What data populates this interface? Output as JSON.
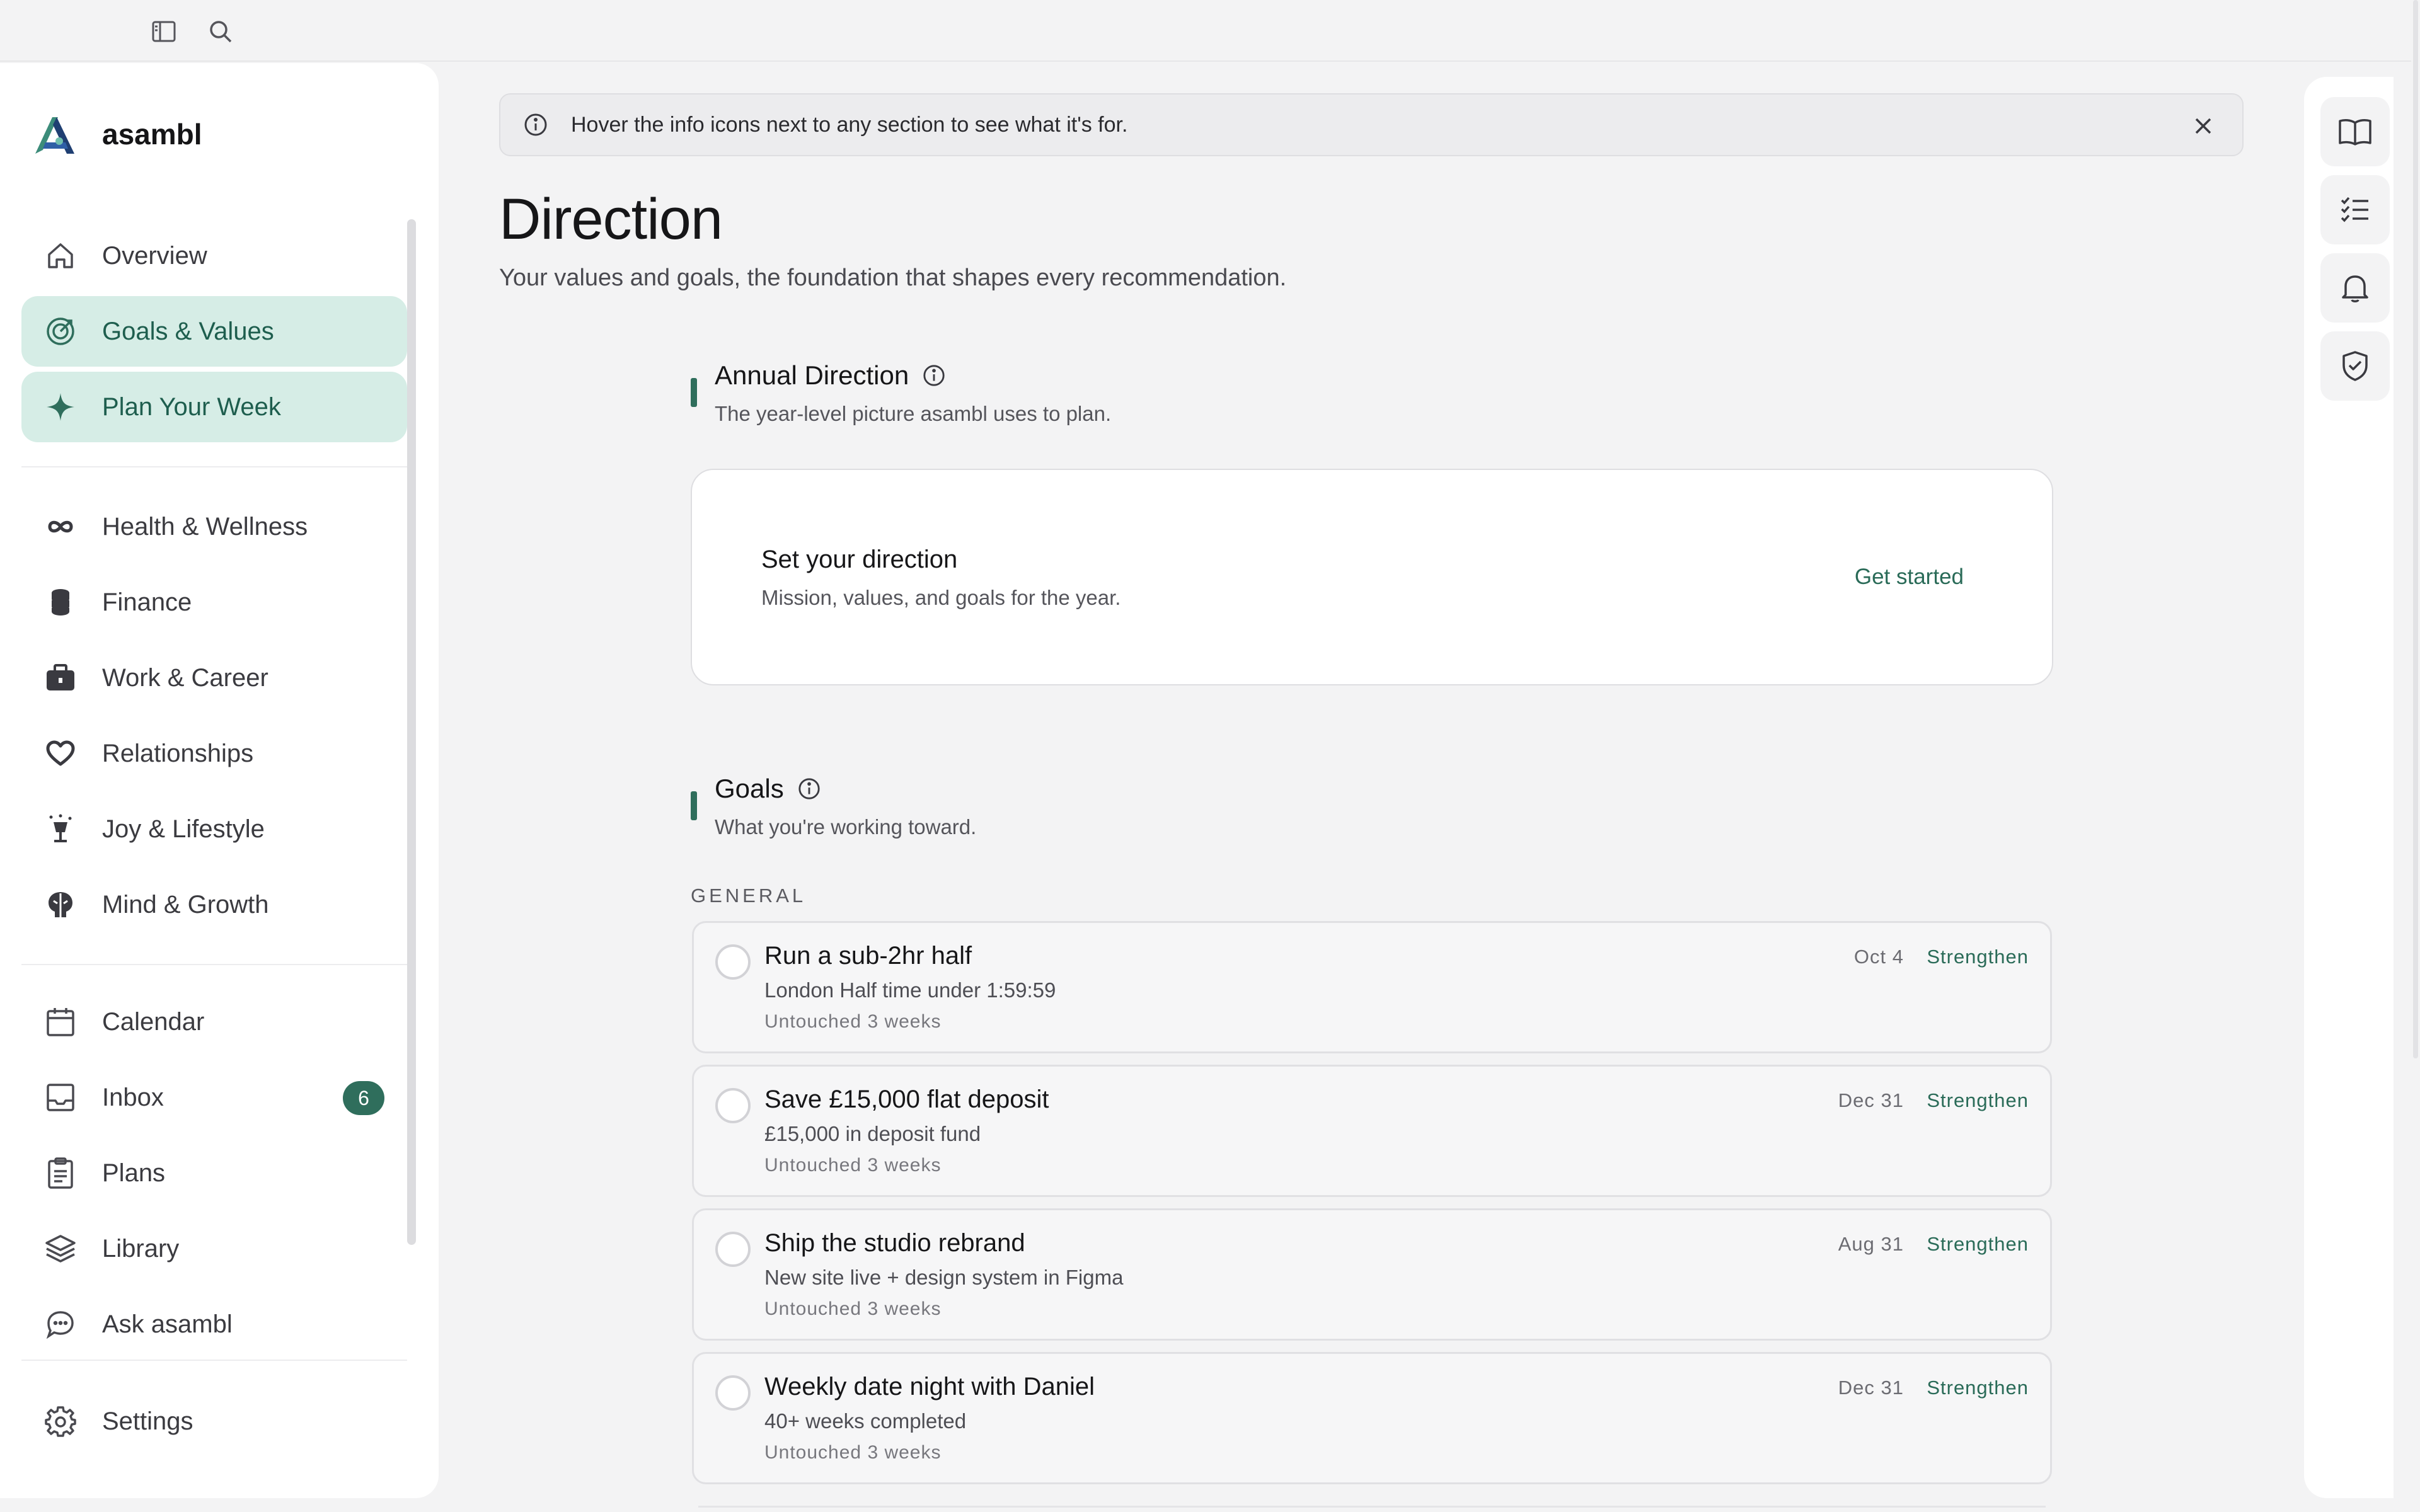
{
  "app": {
    "name": "asambl"
  },
  "banner": {
    "text": "Hover the info icons next to any section to see what it's for."
  },
  "page": {
    "title": "Direction",
    "subtitle": "Your values and goals, the foundation that shapes every recommendation."
  },
  "nav": {
    "primary": [
      {
        "label": "Overview",
        "icon": "home-icon",
        "active": false
      },
      {
        "label": "Goals & Values",
        "icon": "target-icon",
        "active": true
      },
      {
        "label": "Plan Your Week",
        "icon": "sparkle-icon",
        "active": true
      }
    ],
    "areas": [
      {
        "label": "Health & Wellness",
        "icon": "infinity-icon"
      },
      {
        "label": "Finance",
        "icon": "coins-icon"
      },
      {
        "label": "Work & Career",
        "icon": "briefcase-icon"
      },
      {
        "label": "Relationships",
        "icon": "heart-icon"
      },
      {
        "label": "Joy & Lifestyle",
        "icon": "glass-icon"
      },
      {
        "label": "Mind & Growth",
        "icon": "brain-icon"
      }
    ],
    "tools": [
      {
        "label": "Calendar",
        "icon": "calendar-icon"
      },
      {
        "label": "Inbox",
        "icon": "inbox-icon",
        "badge": "6"
      },
      {
        "label": "Plans",
        "icon": "clipboard-icon"
      },
      {
        "label": "Library",
        "icon": "layers-icon"
      },
      {
        "label": "Ask asambl",
        "icon": "chat-icon"
      }
    ],
    "settings": {
      "label": "Settings",
      "icon": "gear-icon"
    }
  },
  "annual": {
    "title": "Annual Direction",
    "description": "The year-level picture asambl uses to plan.",
    "card": {
      "title": "Set your direction",
      "subtitle": "Mission, values, and goals for the year.",
      "cta": "Get started"
    }
  },
  "goals": {
    "title": "Goals",
    "description": "What you're working toward.",
    "group_label": "GENERAL",
    "items": [
      {
        "title": "Run a sub-2hr half",
        "metric": "London Half time under 1:59:59",
        "status": "Untouched 3 weeks",
        "date": "Oct 4",
        "action": "Strengthen"
      },
      {
        "title": "Save £15,000 flat deposit",
        "metric": "£15,000 in deposit fund",
        "status": "Untouched 3 weeks",
        "date": "Dec 31",
        "action": "Strengthen"
      },
      {
        "title": "Ship the studio rebrand",
        "metric": "New site live + design system in Figma",
        "status": "Untouched 3 weeks",
        "date": "Aug 31",
        "action": "Strengthen"
      },
      {
        "title": "Weekly date night with Daniel",
        "metric": "40+ weeks completed",
        "status": "Untouched 3 weeks",
        "date": "Dec 31",
        "action": "Strengthen"
      }
    ]
  },
  "rightbar": [
    "book-icon",
    "checklist-icon",
    "bell-icon",
    "shield-check-icon"
  ],
  "colors": {
    "accent": "#2f6e5c",
    "active_bg": "#d6ede6",
    "link": "#2a6b58"
  }
}
